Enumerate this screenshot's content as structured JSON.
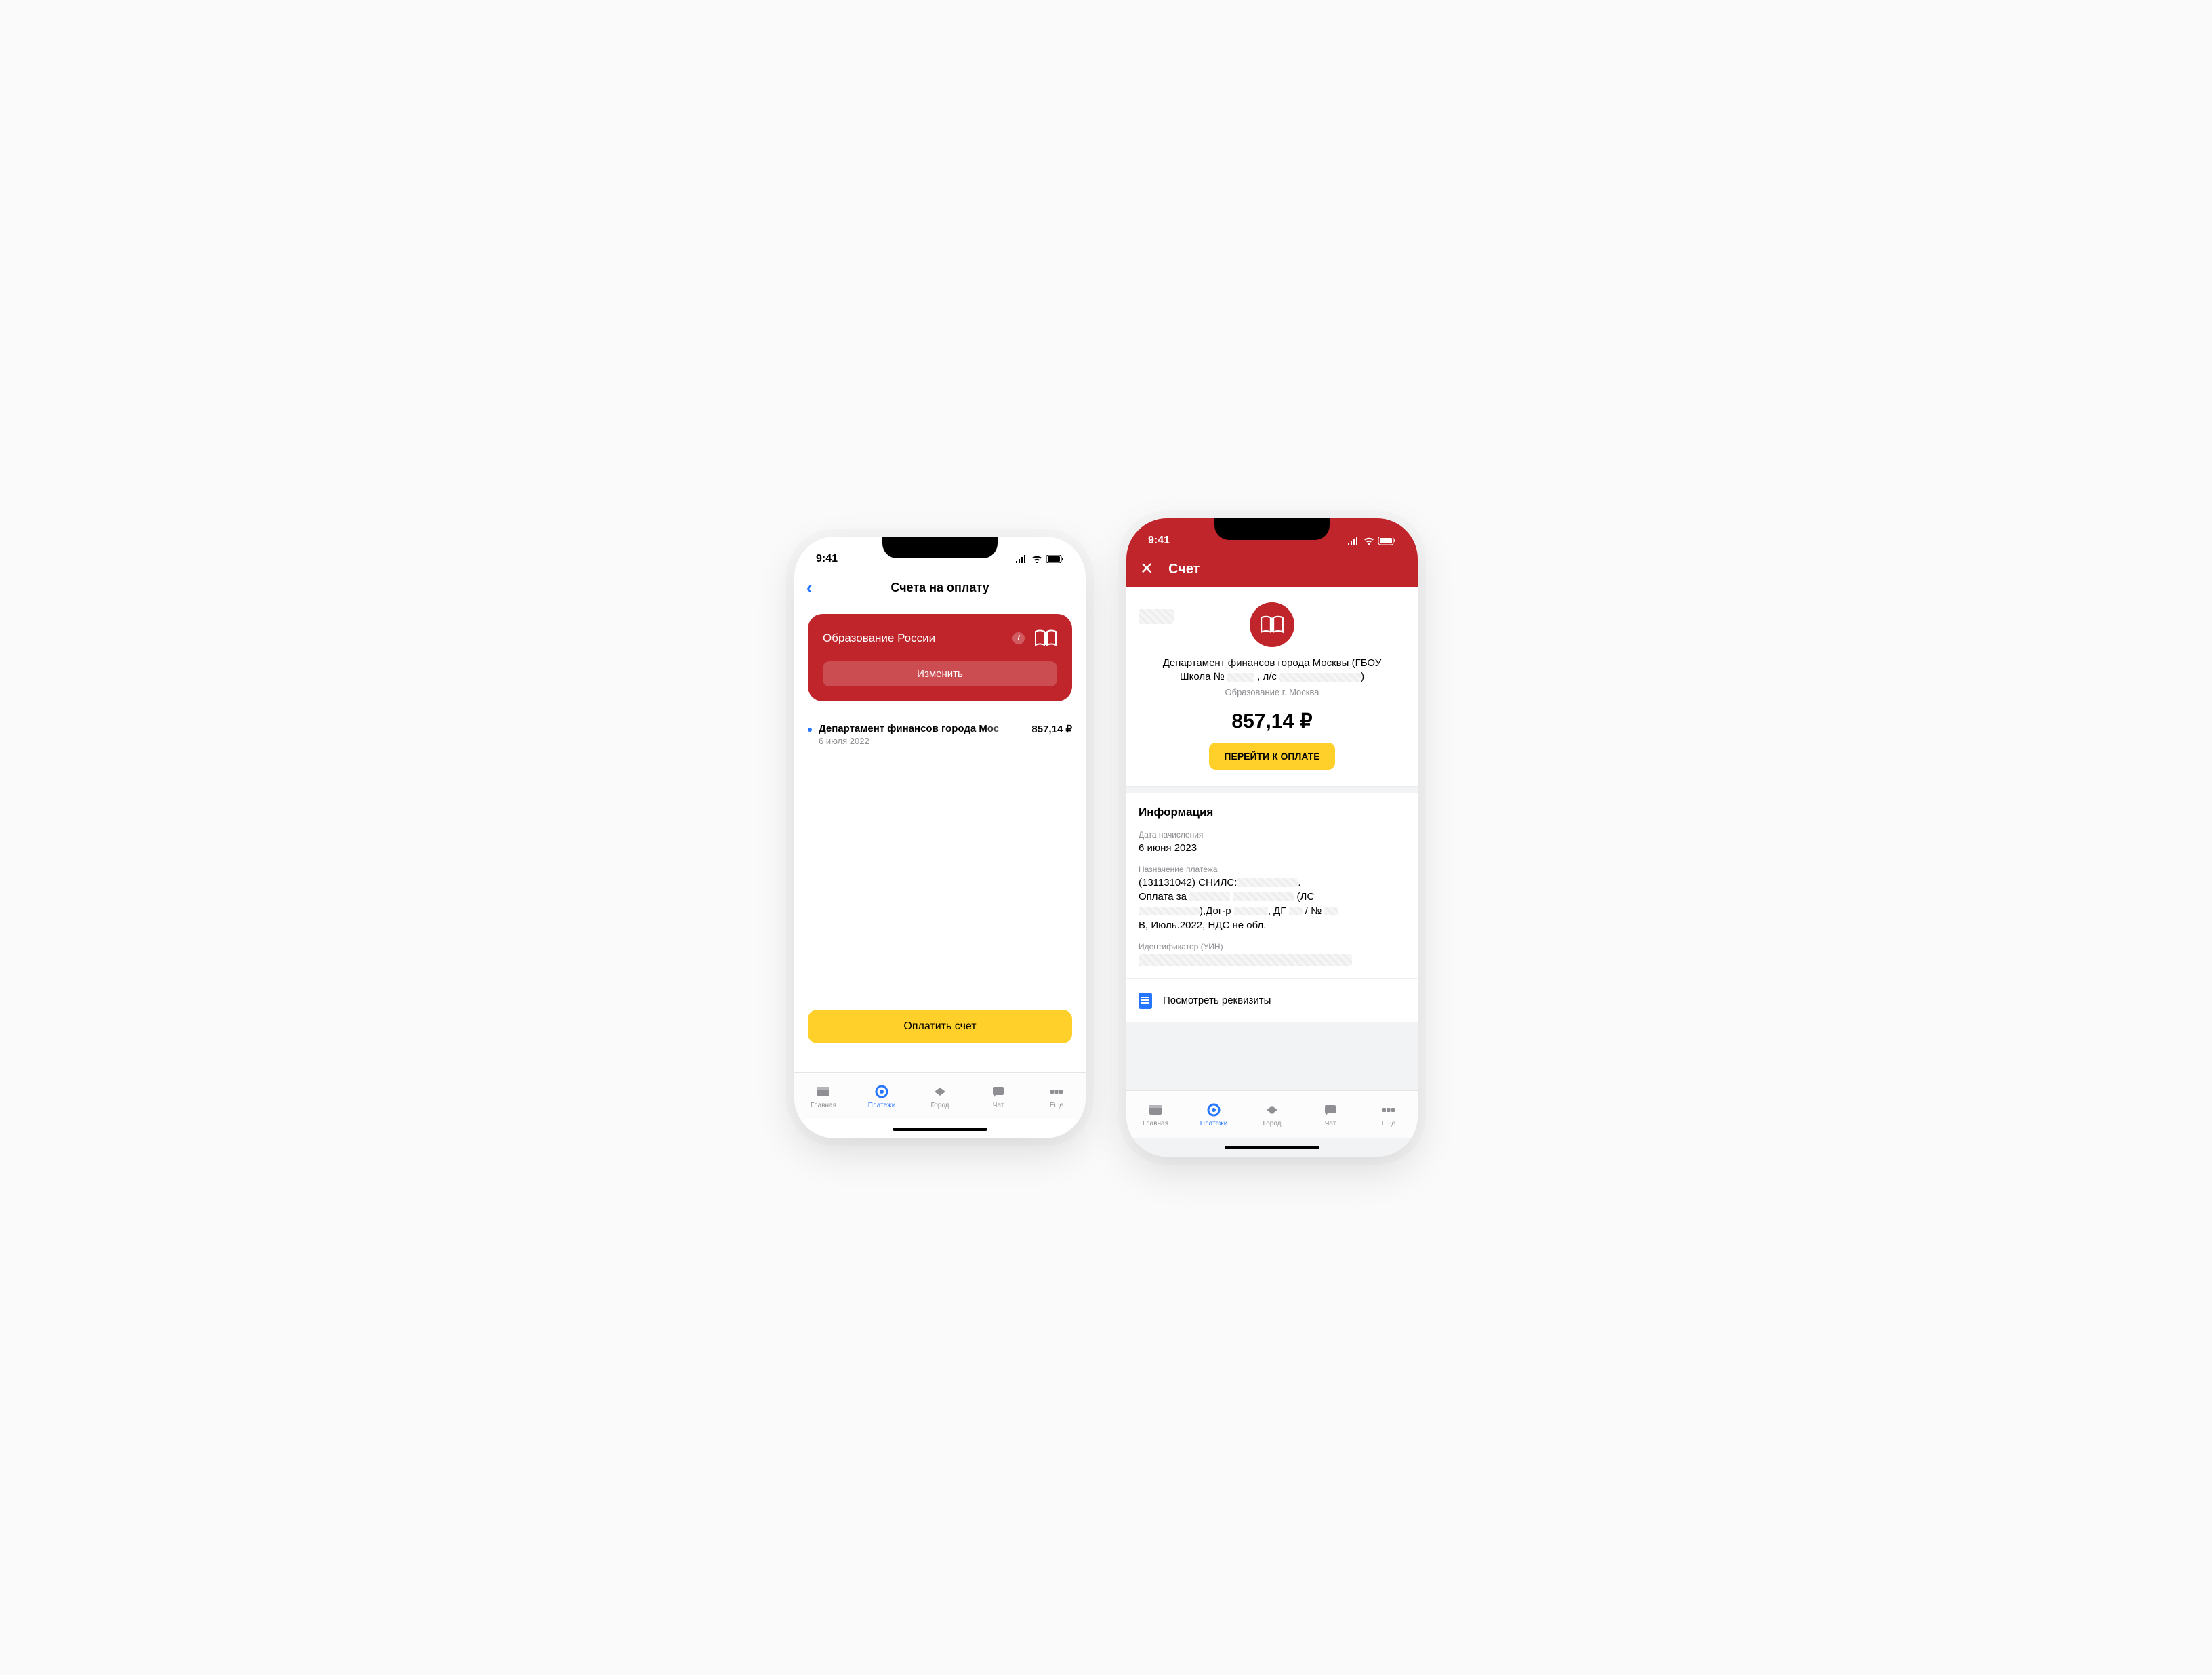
{
  "status": {
    "time": "9:41"
  },
  "left": {
    "nav_title": "Счета на оплату",
    "card": {
      "title": "Образование России",
      "change": "Изменить"
    },
    "item": {
      "title": "Департамент финансов города Мос",
      "date": "6 июля 2022",
      "amount": "857,14 ₽"
    },
    "pay_button": "Оплатить счет"
  },
  "right": {
    "nav_title": "Счет",
    "org_line1": "Департамент финансов города Москвы (ГБОУ",
    "org_line2a": "Школа №",
    "org_line2b": ", л/с",
    "org_line2c": ")",
    "org_sub": "Образование г. Москва",
    "amount": "857,14 ₽",
    "pay": "ПЕРЕЙТИ К ОПЛАТЕ",
    "info_heading": "Информация",
    "date_label": "Дата начисления",
    "date_value": "6 июня 2023",
    "purpose_label": "Назначение платежа",
    "purpose_1": "(131131042) СНИЛС:",
    "purpose_2a": "Оплата за",
    "purpose_2b": "(ЛС",
    "purpose_3a": "),Дог-р",
    "purpose_3b": ", ДГ",
    "purpose_3c": "/ №",
    "purpose_4": "В, Июль.2022, НДС не обл.",
    "uin_label": "Идентификатор (УИН)",
    "view_requisites": "Посмотреть реквизиты"
  },
  "tabs": {
    "home": "Главная",
    "payments": "Платежи",
    "city": "Город",
    "chat": "Чат",
    "more": "Еще"
  }
}
